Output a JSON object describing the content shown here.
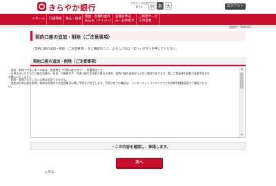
{
  "header": {
    "bank_name": "きらやか銀行",
    "font_size_label": "文字サイズを変更する",
    "font_buttons": [
      "小",
      "あ",
      "大"
    ],
    "logout_label": "ログアウト"
  },
  "nav": {
    "items": [
      {
        "icon": "home-icon",
        "label": "ホーム"
      },
      {
        "icon": "",
        "label": "口座情報"
      },
      {
        "icon": "",
        "label": "振込・振替"
      },
      {
        "icon": "",
        "label": "税金・各種料金の払込み（ペイジー）"
      },
      {
        "icon": "",
        "label": "各種お申込み・お手続き"
      },
      {
        "icon": "",
        "label": "ご利用サービスの変更"
      }
    ]
  },
  "page": {
    "screen_id": "画面ID：RKK010",
    "title": "契約口座の追加・削除（ご注意事項）",
    "instruction": "「契約口座の追加・削除（ご注意事項）」をご確認のうえ、よろしければ「次へ」ボタンを押してください。"
  },
  "terms": {
    "heading": "契約口座の追加・削除（ご注意事項）",
    "lines": [
      "・追加・削除できるご本人口座は、普通預金（代表口座を除く）、貯蓄預金です。",
      "・お申込みいただいた口座の店番号、科目、口座番号が、代表口座のお名前と異なる場合、契約口座の追加を行えない場合があります。実にご登録済の契約の変更手続きをお願いいたします。",
      "・削除・登録されていない口座は追加できません。",
      "・追加はお申込後に即時、削除は処理のため翌営業日以降に手続きが完了します。手続き完了の確認は、インターネットバンキングでご利用時明細書画面でご確認ください。"
    ]
  },
  "confirm": {
    "label": "✓この内容を確認し、承諾します。"
  },
  "buttons": {
    "next": "次へ",
    "back": "戻る"
  },
  "colors": {
    "brand": "#c8102e",
    "nav_bg": "#c8102e"
  }
}
